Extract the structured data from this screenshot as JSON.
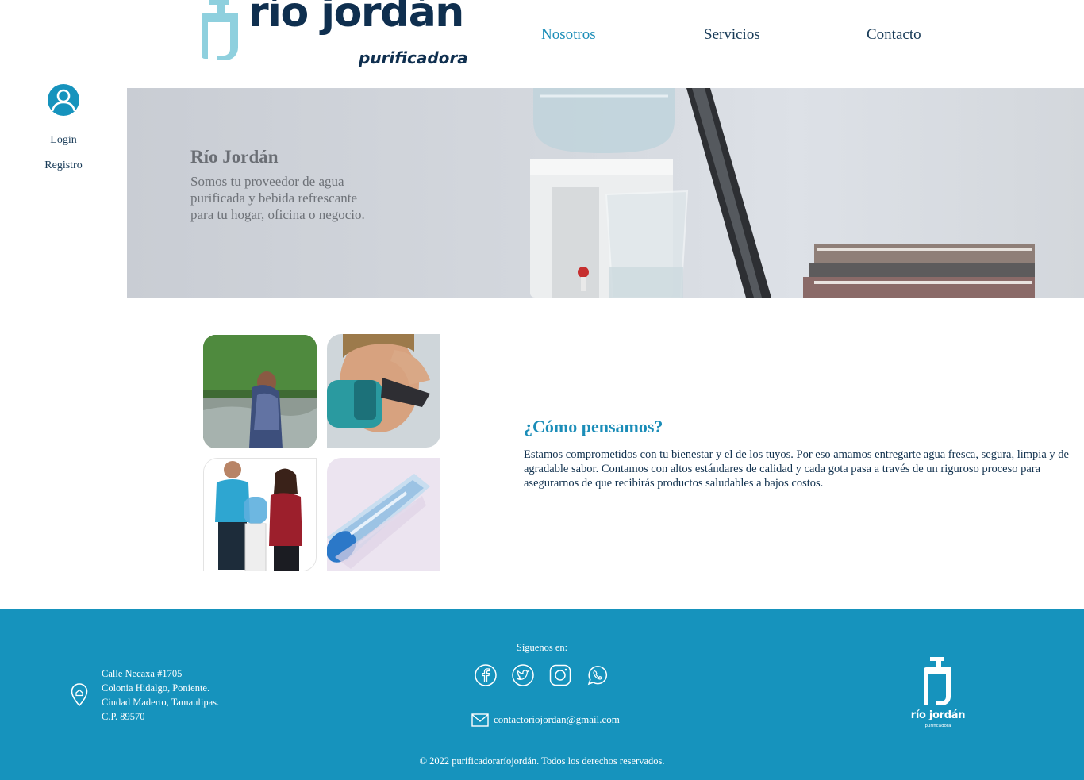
{
  "brand": {
    "name": "río jordán",
    "tagline": "purificadora"
  },
  "nav": {
    "items": [
      {
        "label": "Nosotros",
        "active": true
      },
      {
        "label": "Servicios",
        "active": false
      },
      {
        "label": "Contacto",
        "active": false
      }
    ]
  },
  "user": {
    "icon": "user-avatar-icon",
    "login_label": "Login",
    "register_label": "Registro"
  },
  "hero": {
    "title": "Río Jordán",
    "text": "Somos tu proveedor de agua purificada y bebida refrescante para tu hogar, oficina o negocio."
  },
  "about": {
    "title": "¿Cómo pensamos?",
    "text": "Estamos comprometidos con tu bienestar y el de los tuyos. Por eso amamos entregarte agua fresca, segura, limpia y de agradable sabor. Contamos con altos estándares de calidad y cada gota pasa a través de un riguroso proceso para asegurarnos de que recibirás productos saludables a bajos costos."
  },
  "footer": {
    "address": {
      "line1": "Calle Necaxa #1705",
      "line2": "Colonia Hidalgo, Poniente.",
      "line3": "Ciudad Maderto, Tamaulipas.",
      "line4": "C.P. 89570"
    },
    "follow_label": "Síguenos en:",
    "social": [
      "facebook-icon",
      "twitter-icon",
      "instagram-icon",
      "whatsapp-icon"
    ],
    "email": "contactoriojordan@gmail.com",
    "copyright": "© 2022 purificadoraríojordán. Todos los derechos reservados.",
    "logo_name": "río jordán",
    "logo_tagline": "purificadora"
  },
  "colors": {
    "brand_dark": "#0f2f4f",
    "accent": "#1b8db8",
    "footer_bg": "#1693bd",
    "logo_light": "#8fd0de"
  }
}
